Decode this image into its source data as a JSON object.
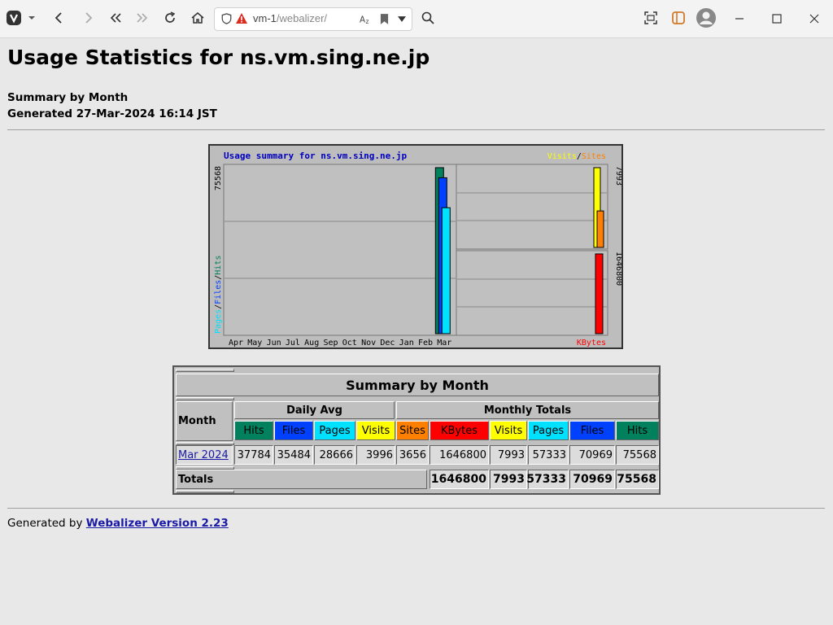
{
  "browser": {
    "url_host": "vm-1",
    "url_path": "/webalizer/"
  },
  "page": {
    "title": "Usage Statistics for ns.vm.sing.ne.jp",
    "subtitle": "Summary by Month",
    "generated": "Generated 27-Mar-2024 16:14 JST",
    "footer_prefix": "Generated by",
    "footer_link": "Webalizer Version 2.23"
  },
  "chart_data": {
    "type": "bar",
    "title": "Usage summary for ns.vm.sing.ne.jp",
    "categories": [
      "Apr",
      "May",
      "Jun",
      "Jul",
      "Aug",
      "Sep",
      "Oct",
      "Nov",
      "Dec",
      "Jan",
      "Feb",
      "Mar"
    ],
    "left_panel": {
      "ylabel_parts": [
        "Pages",
        "/",
        "Files",
        "/",
        "Hits"
      ],
      "ymax_label": "75568",
      "ymax": 75568,
      "series": [
        {
          "name": "Hits",
          "color": "#00805c",
          "values": [
            0,
            0,
            0,
            0,
            0,
            0,
            0,
            0,
            0,
            0,
            0,
            75568
          ]
        },
        {
          "name": "Files",
          "color": "#0040ff",
          "values": [
            0,
            0,
            0,
            0,
            0,
            0,
            0,
            0,
            0,
            0,
            0,
            70969
          ]
        },
        {
          "name": "Pages",
          "color": "#00e0ff",
          "values": [
            0,
            0,
            0,
            0,
            0,
            0,
            0,
            0,
            0,
            0,
            0,
            57333
          ]
        }
      ]
    },
    "right_top_panel": {
      "legend_parts": [
        "Visits",
        "/",
        "Sites"
      ],
      "ymax_label": "7993",
      "ymax": 7993,
      "series": [
        {
          "name": "Visits",
          "color": "#ffff00",
          "values": [
            7993
          ]
        },
        {
          "name": "Sites",
          "color": "#ff8000",
          "values": [
            3656
          ]
        }
      ]
    },
    "right_bottom_panel": {
      "legend": "KBytes",
      "ymax_label": "1646800",
      "ymax": 1646800,
      "series": [
        {
          "name": "KBytes",
          "color": "#ff0000",
          "values": [
            1646800
          ]
        }
      ]
    },
    "grid": true
  },
  "table": {
    "title": "Summary by Month",
    "month_header": "Month",
    "daily_avg_header": "Daily Avg",
    "monthly_totals_header": "Monthly Totals",
    "daily_cols": [
      {
        "label": "Hits",
        "color": "#00805c",
        "text": "#000"
      },
      {
        "label": "Files",
        "color": "#0040ff",
        "text": "#000"
      },
      {
        "label": "Pages",
        "color": "#00e0ff",
        "text": "#000"
      },
      {
        "label": "Visits",
        "color": "#ffff00",
        "text": "#000"
      }
    ],
    "total_cols": [
      {
        "label": "Sites",
        "color": "#ff8000",
        "text": "#000"
      },
      {
        "label": "KBytes",
        "color": "#ff0000",
        "text": "#000"
      },
      {
        "label": "Visits",
        "color": "#ffff00",
        "text": "#000"
      },
      {
        "label": "Pages",
        "color": "#00e0ff",
        "text": "#000"
      },
      {
        "label": "Files",
        "color": "#0040ff",
        "text": "#000"
      },
      {
        "label": "Hits",
        "color": "#00805c",
        "text": "#000"
      }
    ],
    "row": {
      "month": "Mar 2024",
      "values": [
        "37784",
        "35484",
        "28666",
        "3996",
        "3656",
        "1646800",
        "7993",
        "57333",
        "70969",
        "75568"
      ]
    },
    "totals": {
      "label": "Totals",
      "values": [
        "1646800",
        "7993",
        "57333",
        "70969",
        "75568"
      ]
    }
  }
}
